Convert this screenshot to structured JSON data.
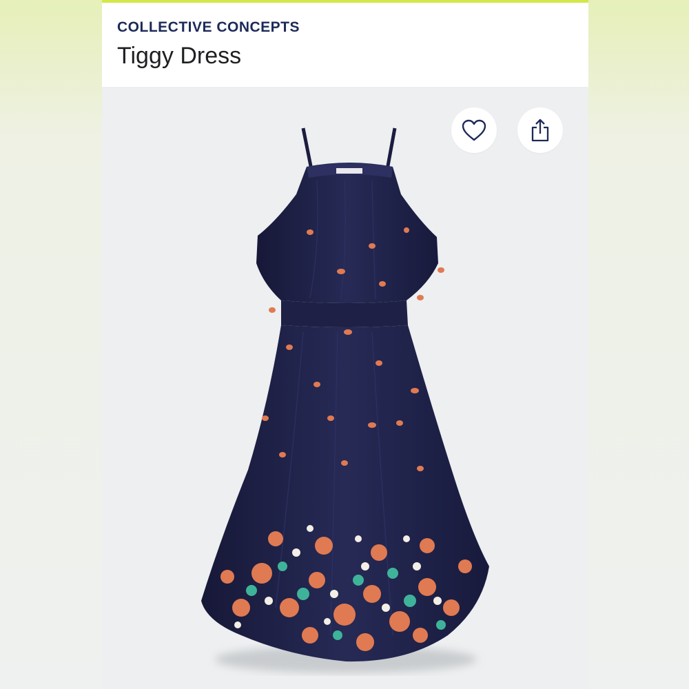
{
  "product": {
    "brand": "COLLECTIVE CONCEPTS",
    "name": "Tiggy Dress"
  },
  "actions": {
    "favorite_icon": "heart-icon",
    "share_icon": "share-icon"
  },
  "colors": {
    "accent_bar": "#d3e84a",
    "brand_text": "#1c2a59",
    "dress_navy": "#20224a",
    "floral_orange": "#e07a52",
    "floral_teal": "#3fb39a"
  }
}
